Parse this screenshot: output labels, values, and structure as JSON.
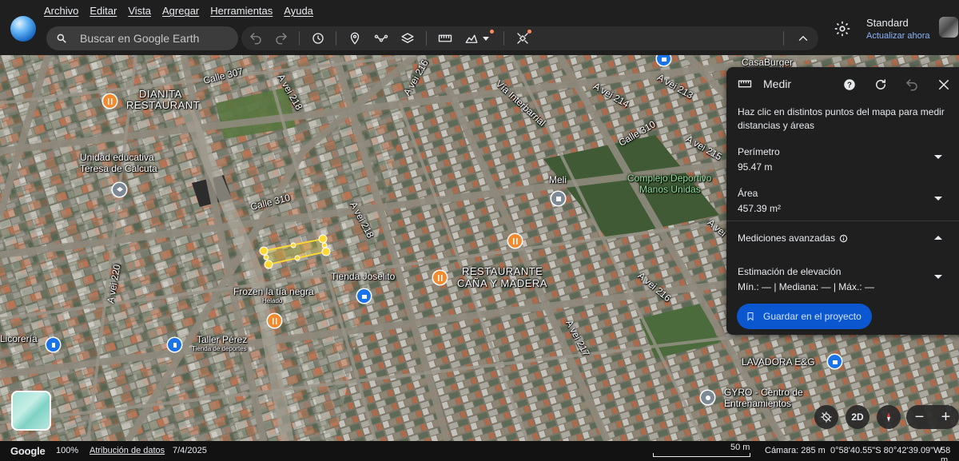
{
  "menu": [
    "Archivo",
    "Editar",
    "Vista",
    "Agregar",
    "Herramientas",
    "Ayuda"
  ],
  "search": {
    "placeholder": "Buscar en Google Earth"
  },
  "toolbar": {
    "icons": [
      "undo-icon",
      "redo-icon",
      "history-icon",
      "pin-icon",
      "path-icon",
      "layers-stack-icon",
      "ruler-icon",
      "area-chart-icon",
      "satellite-icon",
      "collapse-icon"
    ]
  },
  "account": {
    "plan": "Standard",
    "update": "Actualizar ahora"
  },
  "map": {
    "labels": {
      "dianita": "DIANITA",
      "dianita2": "RESTAURANT",
      "calle307": "Calle 307",
      "avei218a": "A vei 218",
      "avei216": "A vei 216",
      "interbarrial": "Vía Interbarrial",
      "avei214": "A vei 214",
      "avei213": "A vei 213",
      "casaburger": "CasaBurger",
      "calle310b": "Calle 310",
      "avei215": "A vei 215",
      "unidad": "Unidad educativa",
      "teresa": "Teresa de Calcuta",
      "meli": "Meli",
      "complejo": "Complejo Deportivo",
      "manos": "Manos Unidas",
      "calle310": "Calle 310",
      "avei218b": "A vei 218",
      "avei220": "A vei 220",
      "tienda": "Tienda Joselito",
      "restaurante": "RESTAURANTE",
      "cana": "CAÑA Y MADERA",
      "frozen": "Frozen la tía negra",
      "helado": "Helado",
      "licoreria": "Licorería",
      "taller": "Taller Pérez",
      "deportes": "Tienda de deportes",
      "avei217": "A vei 217",
      "avei216b": "A vei 216",
      "lavadora": "LAVADORA E&G",
      "gyro": "GYRO - Centro de",
      "entren": "Entrenamientos",
      "avei": "A vei"
    }
  },
  "panel": {
    "title": "Medir",
    "description": "Haz clic en distintos puntos del mapa para medir distancias y áreas",
    "perimeter_label": "Perímetro",
    "perimeter_value": "95.47 m",
    "area_label": "Área",
    "area_value": "457.39 m²",
    "advanced": "Mediciones avanzadas",
    "elevation_label": "Estimación de elevación",
    "elevation_value": "Mín.: — | Mediana: — | Máx.: —",
    "save": "Guardar en el proyecto"
  },
  "controls": {
    "mode_2d": "2D"
  },
  "bottom": {
    "brand": "Google",
    "zoom": "100%",
    "attribution": "Atribución de datos",
    "date": "7/4/2025",
    "scale": "50 m",
    "camera": "Cámara: 285 m",
    "coords": "0°58'40.55\"S 80°42'39.09\"W",
    "alt": "58 m"
  }
}
